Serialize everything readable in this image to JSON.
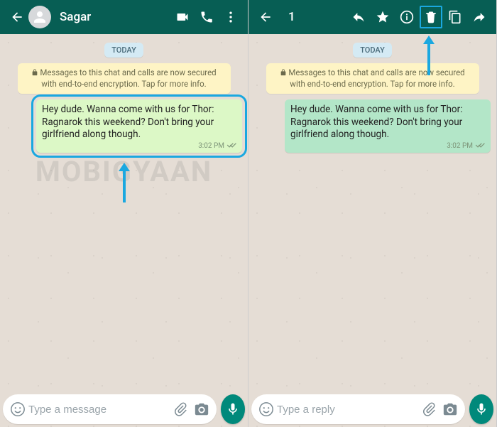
{
  "watermark": "MOBIGYAAN",
  "left": {
    "contact_name": "Sagar",
    "date_label": "TODAY",
    "encryption_notice": "Messages to this chat and calls are now secured with end-to-end encryption. Tap for more info.",
    "message_text": "Hey dude. Wanna come with us for Thor: Ragnarok this weekend? Don't bring your girlfriend along though.",
    "message_time": "3:02 PM",
    "input_placeholder": "Type a message"
  },
  "right": {
    "selected_count": "1",
    "date_label": "TODAY",
    "encryption_notice": "Messages to this chat and calls are now secured with end-to-end encryption. Tap for more info.",
    "message_text": "Hey dude. Wanna come with us for Thor: Ragnarok this weekend? Don't bring your girlfriend along though.",
    "message_time": "3:02 PM",
    "input_placeholder": "Type a reply"
  },
  "colors": {
    "header": "#075E54",
    "accent": "#00897B",
    "bubble_out": "#DCF8C6",
    "bubble_selected": "#B3E6C8",
    "annotation": "#1AA8E0"
  }
}
